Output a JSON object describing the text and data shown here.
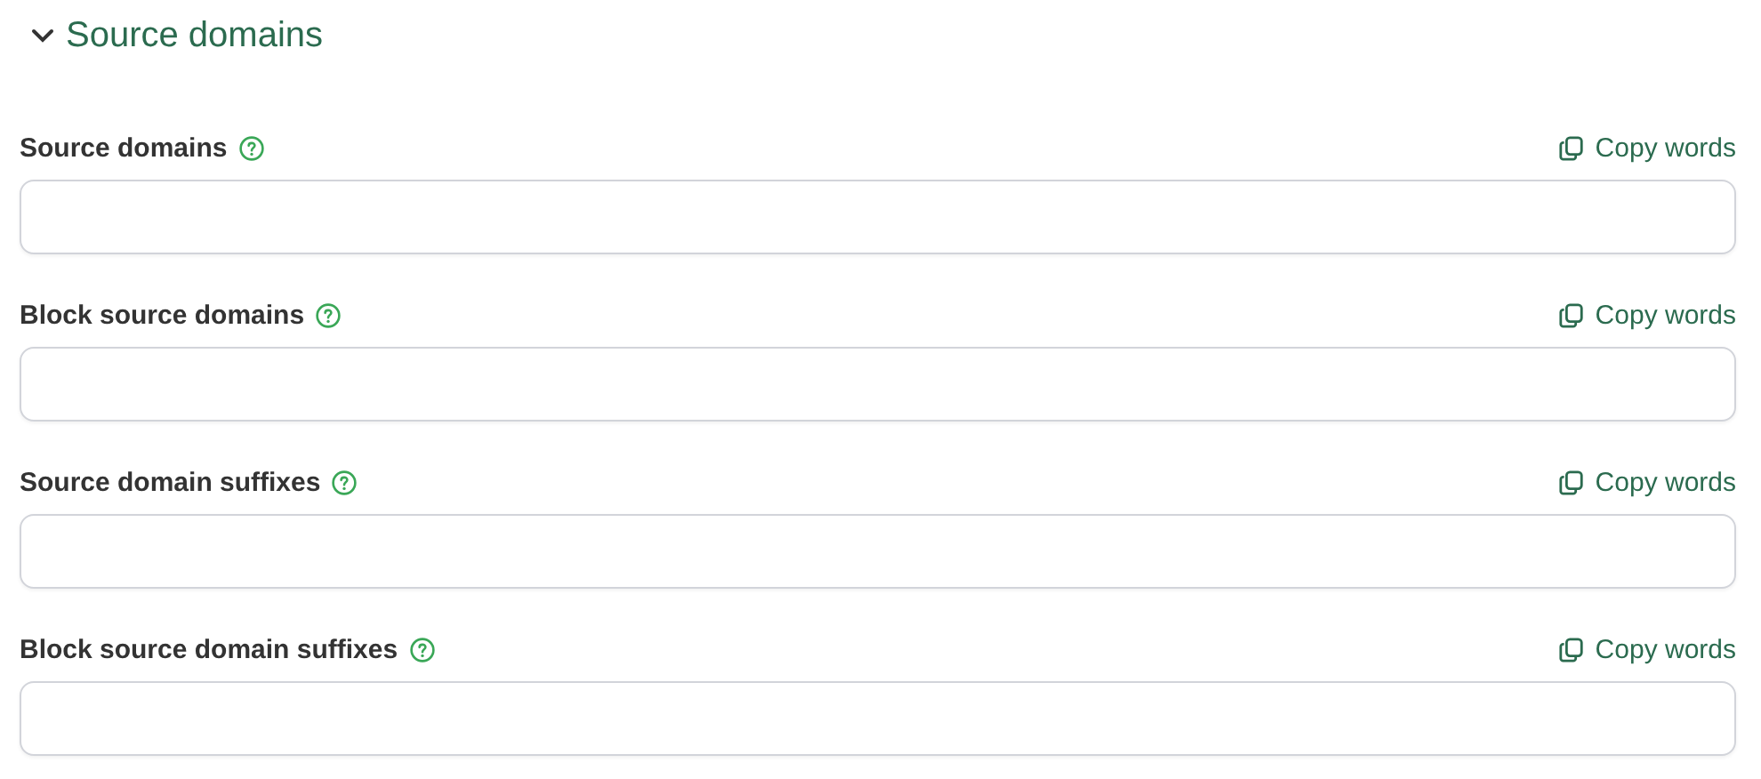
{
  "section": {
    "title": "Source domains",
    "expanded": true
  },
  "fields": [
    {
      "label": "Source domains",
      "action": "Copy words"
    },
    {
      "label": "Block source domains",
      "action": "Copy words"
    },
    {
      "label": "Source domain suffixes",
      "action": "Copy words"
    },
    {
      "label": "Block source domain suffixes",
      "action": "Copy words"
    }
  ]
}
